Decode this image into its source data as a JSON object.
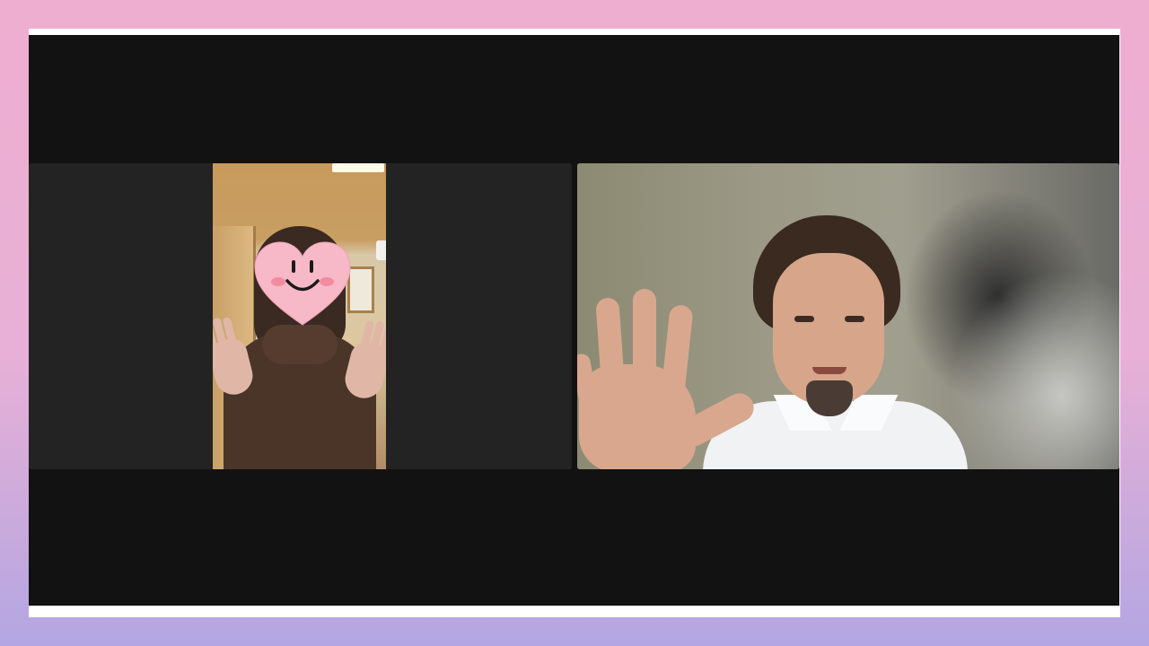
{
  "background": {
    "gradient_top": "#eeaed0",
    "gradient_bottom": "#b3a6e2"
  },
  "meeting_window": {
    "background": "#121212",
    "tile_background": "#232323"
  },
  "participants": [
    {
      "id": "participant-left",
      "face_covered_by": "heart-smiley-sticker",
      "gesture": "waving-both-hands"
    },
    {
      "id": "participant-right",
      "gesture": "waving-one-hand"
    }
  ],
  "icons": {
    "sticker": "heart-smiley-icon"
  }
}
